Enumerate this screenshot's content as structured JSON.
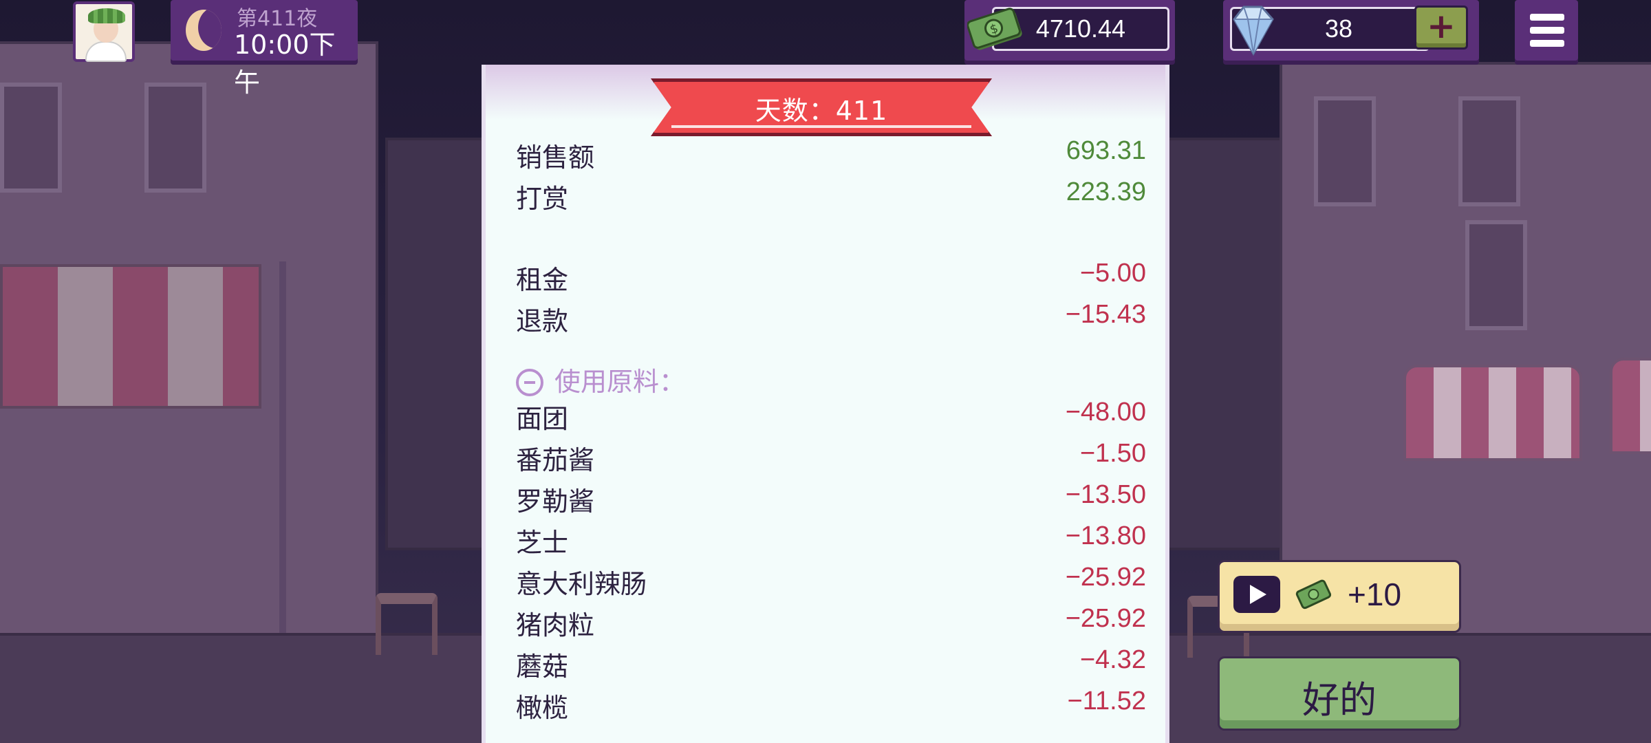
{
  "hud": {
    "night_label": "第411夜",
    "time_label": "10:00下午",
    "money": "4710.44",
    "gems": "38",
    "plus_label": "+"
  },
  "receipt": {
    "banner": "天数：411",
    "income": [
      {
        "label": "销售额",
        "value": "693.31"
      },
      {
        "label": "打赏",
        "value": "223.39"
      }
    ],
    "expenses": [
      {
        "label": "租金",
        "value": "−5.00"
      },
      {
        "label": "退款",
        "value": "−15.43"
      }
    ],
    "ingredients_header": "使用原料：",
    "ingredients": [
      {
        "label": "面团",
        "value": "−48.00"
      },
      {
        "label": "番茄酱",
        "value": "−1.50"
      },
      {
        "label": "罗勒酱",
        "value": "−13.50"
      },
      {
        "label": "芝士",
        "value": "−13.80"
      },
      {
        "label": "意大利辣肠",
        "value": "−25.92"
      },
      {
        "label": "猪肉粒",
        "value": "−25.92"
      },
      {
        "label": "蘑菇",
        "value": "−4.32"
      },
      {
        "label": "橄榄",
        "value": "−11.52"
      }
    ]
  },
  "ad_button": {
    "label": "+10"
  },
  "ok_button": {
    "label": "好的"
  },
  "colors": {
    "hud_purple": "#5a2f78",
    "positive": "#4f8a3a",
    "negative": "#c0314e",
    "banner_red": "#ef4a4e",
    "ok_green": "#8eb97a",
    "ad_yellow": "#f6e3a6"
  },
  "icons": [
    "avatar-portrait",
    "moon-icon",
    "cash-icon",
    "diamond-icon",
    "menu-icon",
    "collapse-minus-icon",
    "video-play-icon"
  ]
}
